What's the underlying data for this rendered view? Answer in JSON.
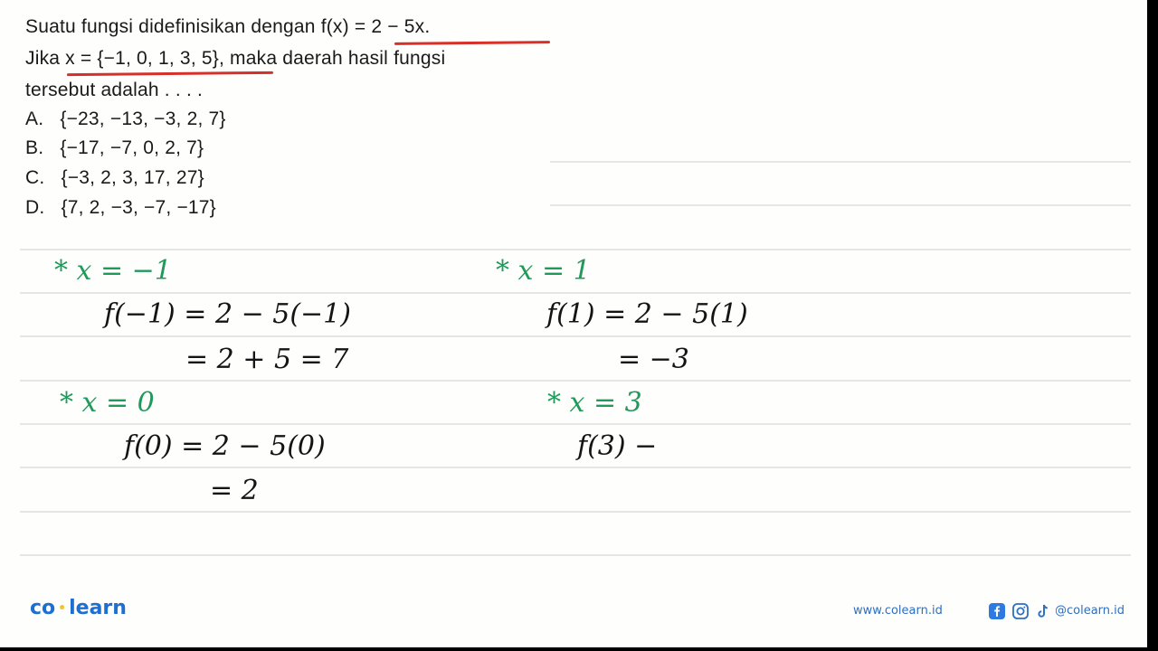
{
  "question": {
    "line1": "Suatu fungsi didefinisikan dengan f(x) = 2 − 5x.",
    "line2": "Jika x = {−1, 0, 1, 3, 5}, maka daerah hasil fungsi",
    "line3": "tersebut adalah . . . .",
    "options": [
      {
        "letter": "A.",
        "text": "{−23, −13, −3, 2, 7}"
      },
      {
        "letter": "B.",
        "text": "{−17, −7, 0, 2, 7}"
      },
      {
        "letter": "C.",
        "text": "{−3, 2, 3, 17, 27}"
      },
      {
        "letter": "D.",
        "text": "{7, 2, −3, −7, −17}"
      }
    ]
  },
  "handwriting": {
    "left": {
      "case1_head": "* x = −1",
      "case1_l1": "f(−1) = 2 − 5(−1)",
      "case1_l2": "= 2 + 5 = 7",
      "case2_head": "* x = 0",
      "case2_l1": "f(0) = 2 − 5(0)",
      "case2_l2": "= 2"
    },
    "right": {
      "case1_head": "* x = 1",
      "case1_l1": "f(1) = 2 − 5(1)",
      "case1_l2": "= −3",
      "case2_head": "* x = 3",
      "case2_l1": "f(3) −"
    }
  },
  "footer": {
    "logo_left": "co",
    "logo_dot": "•",
    "logo_right": "learn",
    "website": "www.colearn.id",
    "social_handle": "@colearn.id",
    "social_icons": [
      "facebook-icon",
      "instagram-icon",
      "tiktok-icon"
    ]
  },
  "colors": {
    "ink_green": "#1f9a5a",
    "ink_black": "#141414",
    "underline_red": "#d6302a",
    "brand_blue": "#1e6fd0"
  }
}
